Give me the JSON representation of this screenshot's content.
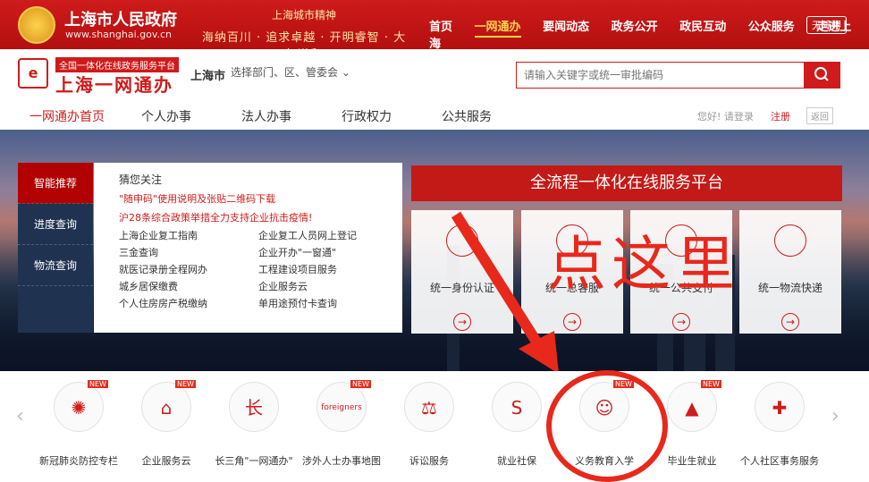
{
  "top": {
    "title": "上海市人民政府",
    "url": "www.shanghai.gov.cn",
    "spirit_title": "上海城市精神",
    "spirit_slogan": "海纳百川 · 追求卓越 · 开明睿智 · 大气谦和",
    "nav": [
      "首页",
      "一网通办",
      "要闻动态",
      "政务公开",
      "政民互动",
      "公众服务",
      "走进上海"
    ],
    "nav_active": "一网通办",
    "accessibility": "无障碍"
  },
  "header": {
    "logo_tagline": "全国一体化在线政务服务平台",
    "logo_name": "上海一网通办",
    "city": "上海市",
    "dept_select": "选择部门、区、管委会",
    "search_placeholder": "请输入关键字或统一审批编码"
  },
  "mainnav": {
    "items": [
      "一网通办首页",
      "个人办事",
      "法人办事",
      "行政权力",
      "公共服务"
    ],
    "greeting": "您好! 请登录",
    "register": "注册",
    "back": "返回"
  },
  "sidebar": {
    "items": [
      "智能推荐",
      "进度查询",
      "物流查询"
    ]
  },
  "attention": {
    "title": "猜您关注",
    "line1": "\"随申码\"使用说明及张贴二维码下载",
    "line2": "沪28条综合政策举措全力支持企业抗击疫情!",
    "grid": [
      "上海企业复工指南",
      "企业复工人员网上登记",
      "三金查询",
      "企业开办\"一窗通\"",
      "就医记录册全程网办",
      "工程建设项目服务",
      "城乡居保缴费",
      "企业服务云",
      "个人住房房产税缴纳",
      "单用途预付卡查询"
    ]
  },
  "platform": {
    "title": "全流程一体化在线服务平台",
    "cards": [
      "统一身份认证",
      "统一总客服",
      "统一公共支付",
      "统一物流快递"
    ]
  },
  "overlay": {
    "text": "点这里"
  },
  "services": {
    "items": [
      "新冠肺炎防控专栏",
      "企业服务云",
      "长三角\"一网通办\"",
      "涉外人士办事地图",
      "诉讼服务",
      "就业社保",
      "义务教育入学",
      "毕业生就业",
      "个人社区事务服务"
    ],
    "new_label": "NEW",
    "foreigners_label": "foreigners"
  }
}
